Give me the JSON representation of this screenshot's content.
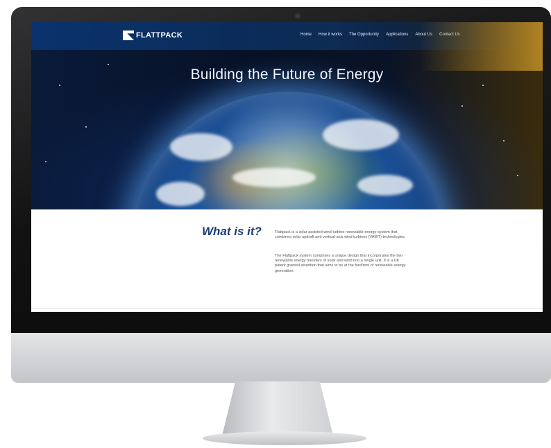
{
  "site": {
    "logo_text": "FLATTPACK",
    "nav": [
      "Home",
      "How it works",
      "The Opportunity",
      "Applications",
      "About Us",
      "Contact Us"
    ],
    "hero_title": "Building the Future of Energy",
    "section_heading": "What is it?",
    "paragraphs": [
      "Flattpack is a solar assisted wind turbine renewable energy system that combines solar updraft and vertical-axis wind turbines (VAWT) technologies.",
      "The Flattpack system comprises a unique design that incorporates the two renewable energy transfers of solar and wind into a single unit. It is a UK patent granted invention that aims to be at the forefront of renewable energy generation."
    ]
  },
  "colors": {
    "heading_blue": "#1c3f78",
    "bezel": "#111113",
    "chin": "#d2d3d6"
  }
}
